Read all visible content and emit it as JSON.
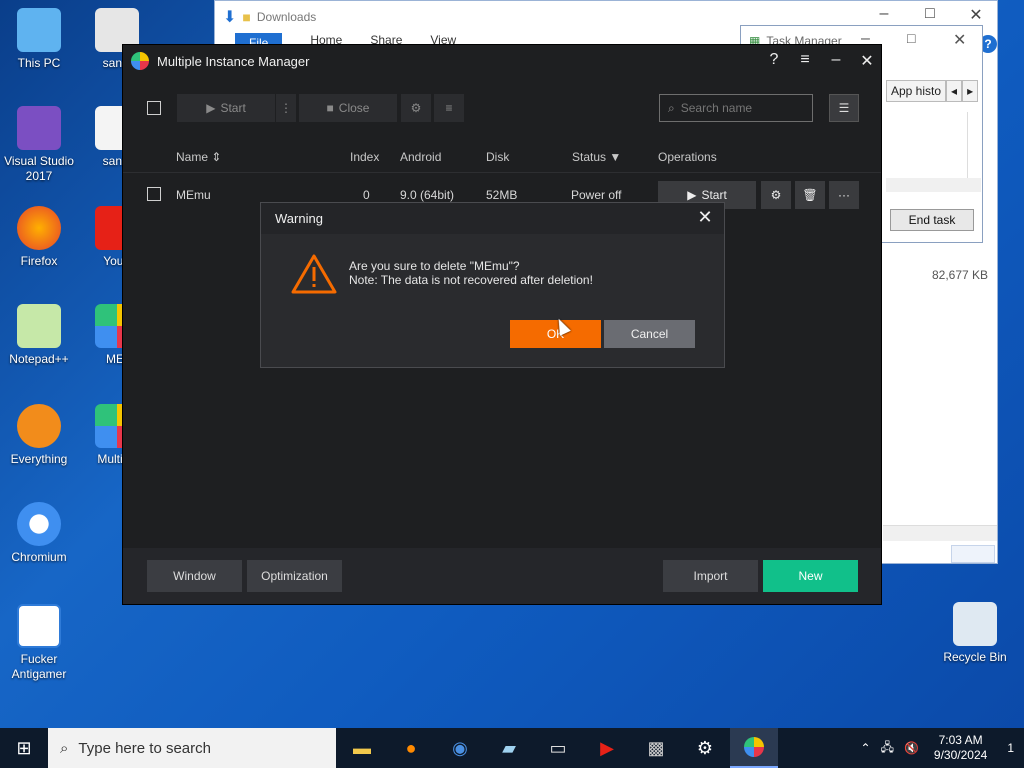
{
  "desktop": {
    "icons": [
      {
        "label": "This PC",
        "glyph": "🖥"
      },
      {
        "label": "sandl",
        "glyph": "⚙"
      },
      {
        "label": "Visual Studio 2017",
        "glyph": "◆"
      },
      {
        "label": "sandl",
        "glyph": "📄"
      },
      {
        "label": "Firefox",
        "glyph": "🦊"
      },
      {
        "label": "YouT",
        "glyph": "▶"
      },
      {
        "label": "Notepad++",
        "glyph": "🦎"
      },
      {
        "label": "MEr",
        "glyph": "◆"
      },
      {
        "label": "Everything",
        "glyph": "🔍"
      },
      {
        "label": "Multi-M",
        "glyph": "◆"
      },
      {
        "label": "Chromium",
        "glyph": "◉"
      },
      {
        "label": "Fucker Antigamer",
        "glyph": "▣"
      },
      {
        "label": "Recycle Bin",
        "glyph": "♻"
      }
    ]
  },
  "explorer": {
    "title": "Downloads",
    "ribbon": [
      "File",
      "Home",
      "Share",
      "View"
    ]
  },
  "taskmgr": {
    "title": "Task Manager",
    "tab": "App histo",
    "end_task": "End task",
    "memory": "82,677 KB"
  },
  "mim": {
    "title": "Multiple Instance Manager",
    "toolbar": {
      "start": "Start",
      "close": "Close",
      "search_placeholder": "Search name"
    },
    "columns": {
      "name": "Name",
      "index": "Index",
      "android": "Android",
      "disk": "Disk",
      "status": "Status",
      "operations": "Operations"
    },
    "row": {
      "name": "MEmu",
      "index": "0",
      "android": "9.0 (64bit)",
      "disk": "52MB",
      "status": "Power off",
      "start": "Start",
      "more": "···"
    },
    "footer": {
      "window": "Window",
      "optimization": "Optimization",
      "import": "Import",
      "new": "New"
    }
  },
  "dialog": {
    "title": "Warning",
    "line1": "Are you sure to delete \"MEmu\"?",
    "line2": "Note: The data is not recovered after deletion!",
    "ok": "OK",
    "cancel": "Cancel"
  },
  "taskbar": {
    "search_placeholder": "Type here to search",
    "time": "7:03 AM",
    "date": "9/30/2024",
    "notifications": "1"
  },
  "colors": {
    "accent_orange": "#f56b00",
    "accent_green": "#11c08a"
  }
}
